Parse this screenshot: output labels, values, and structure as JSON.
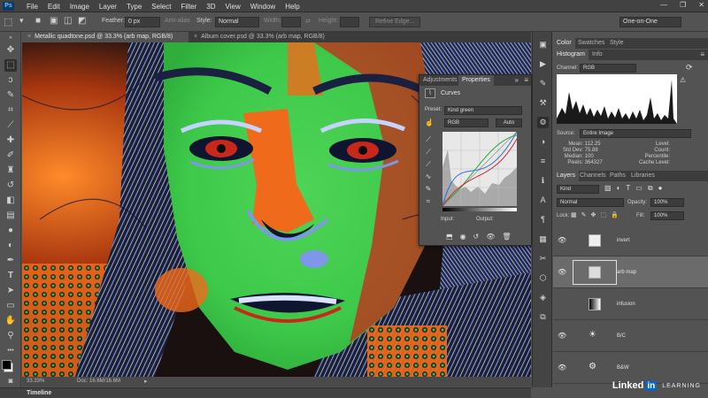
{
  "app": {
    "logo": "Ps"
  },
  "menu": [
    "File",
    "Edit",
    "Image",
    "Layer",
    "Type",
    "Select",
    "Filter",
    "3D",
    "View",
    "Window",
    "Help"
  ],
  "window_controls": [
    "—",
    "❐",
    "✕"
  ],
  "options_bar": {
    "feather_label": "Feather:",
    "feather_value": "0 px",
    "anti_alias": "Anti-alias",
    "style_label": "Style:",
    "style_value": "Normal",
    "width_label": "Width:",
    "height_label": "Height:",
    "refine_edge": "Refine Edge...",
    "workspace": "One-on-One"
  },
  "doc_tabs": [
    {
      "label": "Metallic quadtone.psd @ 33.3% (arb map, RGB/8)",
      "active": true
    },
    {
      "label": "Album cover.psd @ 33.3% (arb map, RGB/8)",
      "active": false
    }
  ],
  "status": {
    "zoom": "33.33%",
    "doc": "Doc: 16.6M/16.6M"
  },
  "timeline": "Timeline",
  "properties": {
    "tab_adjustments": "Adjustments",
    "tab_properties": "Properties",
    "type": "Curves",
    "preset_label": "Preset:",
    "preset_value": "Kind green",
    "channel_value": "RGB",
    "auto_label": "Auto",
    "input_label": "Input:",
    "output_label": "Output:"
  },
  "top_panel_tabs": [
    "Color",
    "Swatches",
    "Style"
  ],
  "histogram": {
    "tabs": [
      "Histogram",
      "Info"
    ],
    "channel_label": "Channel:",
    "channel_value": "RGB",
    "source_label": "Source:",
    "source_value": "Entire Image",
    "stats_left": [
      {
        "k": "Mean:",
        "v": "112.25"
      },
      {
        "k": "Std Dev:",
        "v": "75.88"
      },
      {
        "k": "Median:",
        "v": "100"
      },
      {
        "k": "Pixels:",
        "v": "364327"
      }
    ],
    "stats_right": [
      "Level:",
      "Count:",
      "Percentile:",
      "Cache Level:"
    ]
  },
  "layers_panel": {
    "tabs": [
      "Layers",
      "Channels",
      "Paths",
      "Libraries"
    ],
    "kind_value": "Kind",
    "blend_value": "Normal",
    "opacity_label": "Opacity:",
    "opacity_value": "100%",
    "lock_label": "Lock:",
    "fill_label": "Fill:",
    "fill_value": "100%",
    "layers": [
      {
        "name": "invert",
        "selected": false
      },
      {
        "name": "arb map",
        "selected": true
      },
      {
        "name": "infusion",
        "selected": false
      },
      {
        "name": "B/C",
        "selected": false
      },
      {
        "name": "B&W",
        "selected": false
      }
    ]
  },
  "watermark": {
    "brand": "Linked",
    "in": "in",
    "learning": "LEARNING"
  },
  "colors": {
    "green": "#3ec94a",
    "orange": "#f06a1c",
    "blue": "#7f97e8",
    "red": "#c8281a"
  }
}
